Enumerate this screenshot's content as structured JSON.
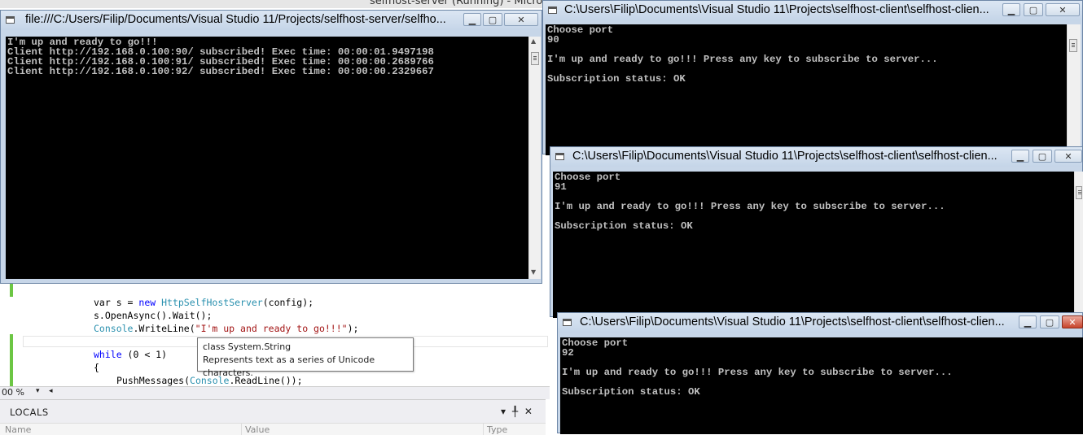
{
  "vs": {
    "background_title": "selfhost-server (Running) - Micro",
    "code_lines": [
      {
        "pre": "var s = ",
        "kw": "new",
        "type": "HttpSelfHostServer",
        "post": "(config);"
      },
      {
        "text": "s.OpenAsync().Wait();"
      },
      {
        "type": "Console",
        "mid": ".WriteLine(",
        "str": "\"I'm up and ready to go!!!\"",
        "post": ");"
      },
      {
        "kw": "while",
        "post": " (0 < 1)"
      },
      {
        "text": "{"
      },
      {
        "method": "PushMessages(",
        "type": "Console",
        "post": ".ReadLine());"
      }
    ],
    "tooltip": {
      "line1": "class System.String",
      "line2": "Represents text as a series of Unicode characters."
    },
    "statusbar": {
      "zoom": "00 %",
      "dropdown": "▾"
    },
    "locals": {
      "title": "LOCALS",
      "buttons": [
        "▾",
        "╀",
        "✕"
      ],
      "columns": [
        "Name",
        "Value",
        "Type"
      ]
    }
  },
  "windows": {
    "server": {
      "title": "file:///C:/Users/Filip/Documents/Visual Studio 11/Projects/selfhost-server/selfho...",
      "lines": [
        "I'm up and ready to go!!!",
        "Client http://192.168.0.100:90/ subscribed! Exec time: 00:00:01.9497198",
        "Client http://192.168.0.100:91/ subscribed! Exec time: 00:00:00.2689766",
        "Client http://192.168.0.100:92/ subscribed! Exec time: 00:00:00.2329667"
      ]
    },
    "client1": {
      "title": "C:\\Users\\Filip\\Documents\\Visual Studio 11\\Projects\\selfhost-client\\selfhost-clien...",
      "lines": [
        "Choose port",
        "90",
        "",
        "I'm up and ready to go!!! Press any key to subscribe to server...",
        "",
        "Subscription status: OK"
      ]
    },
    "client2": {
      "title": "C:\\Users\\Filip\\Documents\\Visual Studio 11\\Projects\\selfhost-client\\selfhost-clien...",
      "lines": [
        "Choose port",
        "91",
        "",
        "I'm up and ready to go!!! Press any key to subscribe to server...",
        "",
        "Subscription status: OK"
      ]
    },
    "client3": {
      "title": "C:\\Users\\Filip\\Documents\\Visual Studio 11\\Projects\\selfhost-client\\selfhost-clien...",
      "lines": [
        "Choose port",
        "92",
        "",
        "I'm up and ready to go!!! Press any key to subscribe to server...",
        "",
        "Subscription status: OK"
      ]
    }
  },
  "controls": {
    "minimize": "▁",
    "maximize": "▢",
    "close": "✕"
  }
}
